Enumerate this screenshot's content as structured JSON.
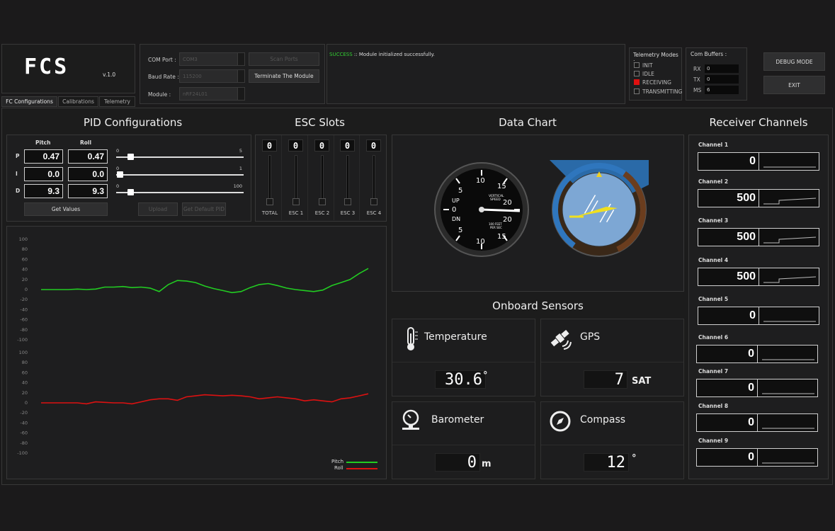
{
  "app": {
    "logo": "FCS",
    "version": "v.1.0"
  },
  "tabs": [
    "FC Configurations",
    "Calibrations",
    "Telemetry"
  ],
  "connection": {
    "com_port_label": "COM Port :",
    "com_port_value": "COM3",
    "baud_label": "Baud Rate :",
    "baud_value": "115200",
    "module_label": "Module :",
    "module_value": "nRF24L01",
    "scan_button": "Scan Ports",
    "terminate_button": "Terminate The Module"
  },
  "log": {
    "status": "SUCCESS",
    "message": " :: Module initialized successfully."
  },
  "telemetry_modes": {
    "title": "Telemetry Modes :",
    "items": [
      "INIT",
      "IDLE",
      "RECEIVING",
      "TRANSMITTING"
    ],
    "active": 2
  },
  "com_buffers": {
    "title": "Com Buffers :",
    "rx_label": "RX",
    "rx": "0",
    "tx_label": "TX",
    "tx": "0",
    "ms_label": "MS",
    "ms": "6"
  },
  "buttons": {
    "debug": "DEBUG MODE",
    "exit": "EXIT"
  },
  "pid": {
    "title": "PID Configurations",
    "pitch_label": "Pitch",
    "roll_label": "Roll",
    "rows": [
      {
        "name": "P",
        "pitch": "0.47",
        "roll": "0.47",
        "min": "0",
        "max": "5"
      },
      {
        "name": "I",
        "pitch": "0.0",
        "roll": "0.0",
        "min": "0",
        "max": "1"
      },
      {
        "name": "D",
        "pitch": "9.3",
        "roll": "9.3",
        "min": "0",
        "max": "100"
      }
    ],
    "get_values": "Get Values",
    "upload": "Upload",
    "get_default": "Get Default PID"
  },
  "esc": {
    "title": "ESC Slots",
    "slots": [
      {
        "label": "TOTAL",
        "value": "0"
      },
      {
        "label": "ESC 1",
        "value": "0"
      },
      {
        "label": "ESC 2",
        "value": "0"
      },
      {
        "label": "ESC 3",
        "value": "0"
      },
      {
        "label": "ESC 4",
        "value": "0"
      }
    ]
  },
  "data_chart_title": "Data Chart",
  "vsi": {
    "label": "VERTICAL\nSPEED",
    "unit": "100 FEET\nPER SEC",
    "up": "UP",
    "dn": "DN",
    "ticks": [
      "10",
      "15",
      "20",
      "20",
      "15",
      "10",
      "5",
      "0",
      "5"
    ]
  },
  "sensors": {
    "title": "Onboard Sensors",
    "items": [
      {
        "name": "Temperature",
        "value": "30.6",
        "unit": "°",
        "icon": "thermometer-icon"
      },
      {
        "name": "GPS",
        "value": "7",
        "unit": "SAT",
        "icon": "satellite-icon"
      },
      {
        "name": "Barometer",
        "value": "0",
        "unit": "m",
        "icon": "barometer-icon"
      },
      {
        "name": "Compass",
        "value": "12",
        "unit": "°",
        "icon": "compass-icon"
      }
    ]
  },
  "receiver": {
    "title": "Receiver Channels",
    "channels": [
      {
        "name": "Channel 1",
        "value": "0",
        "level": 0
      },
      {
        "name": "Channel 2",
        "value": "500",
        "level": 0.5
      },
      {
        "name": "Channel 3",
        "value": "500",
        "level": 0.5
      },
      {
        "name": "Channel 4",
        "value": "500",
        "level": 0.5
      },
      {
        "name": "Channel 5",
        "value": "0",
        "level": 0
      },
      {
        "name": "Channel 6",
        "value": "0",
        "level": 0
      },
      {
        "name": "Channel 7",
        "value": "0",
        "level": 0
      },
      {
        "name": "Channel 8",
        "value": "0",
        "level": 0
      },
      {
        "name": "Channel 9",
        "value": "0",
        "level": 0
      }
    ]
  },
  "chart_data": [
    {
      "type": "line",
      "ylim": [
        -100,
        100
      ],
      "yticks": [
        "100",
        "80",
        "60",
        "40",
        "20",
        "0",
        "-20",
        "-40",
        "-60",
        "-80",
        "-100"
      ],
      "series": [
        {
          "name": "Pitch",
          "color": "#22cc22",
          "values": [
            0,
            0,
            0,
            0,
            1,
            0,
            1,
            5,
            5,
            6,
            4,
            5,
            3,
            -4,
            10,
            18,
            17,
            14,
            7,
            2,
            -2,
            -6,
            -4,
            4,
            10,
            12,
            8,
            3,
            0,
            -2,
            -4,
            -1,
            8,
            14,
            20,
            32,
            42
          ]
        }
      ]
    },
    {
      "type": "line",
      "ylim": [
        -100,
        100
      ],
      "yticks": [
        "100",
        "80",
        "60",
        "40",
        "20",
        "0",
        "-20",
        "-40",
        "-60",
        "-80",
        "-100"
      ],
      "series": [
        {
          "name": "Roll",
          "color": "#dd1111",
          "values": [
            0,
            0,
            0,
            0,
            0,
            -2,
            2,
            1,
            0,
            0,
            -2,
            2,
            6,
            8,
            8,
            5,
            12,
            14,
            16,
            15,
            14,
            15,
            14,
            12,
            8,
            10,
            12,
            10,
            8,
            4,
            6,
            4,
            2,
            8,
            10,
            14,
            18
          ]
        }
      ]
    }
  ],
  "legend": {
    "pitch": "Pitch",
    "roll": "Roll",
    "pitch_color": "#22cc22",
    "roll_color": "#dd1111"
  }
}
